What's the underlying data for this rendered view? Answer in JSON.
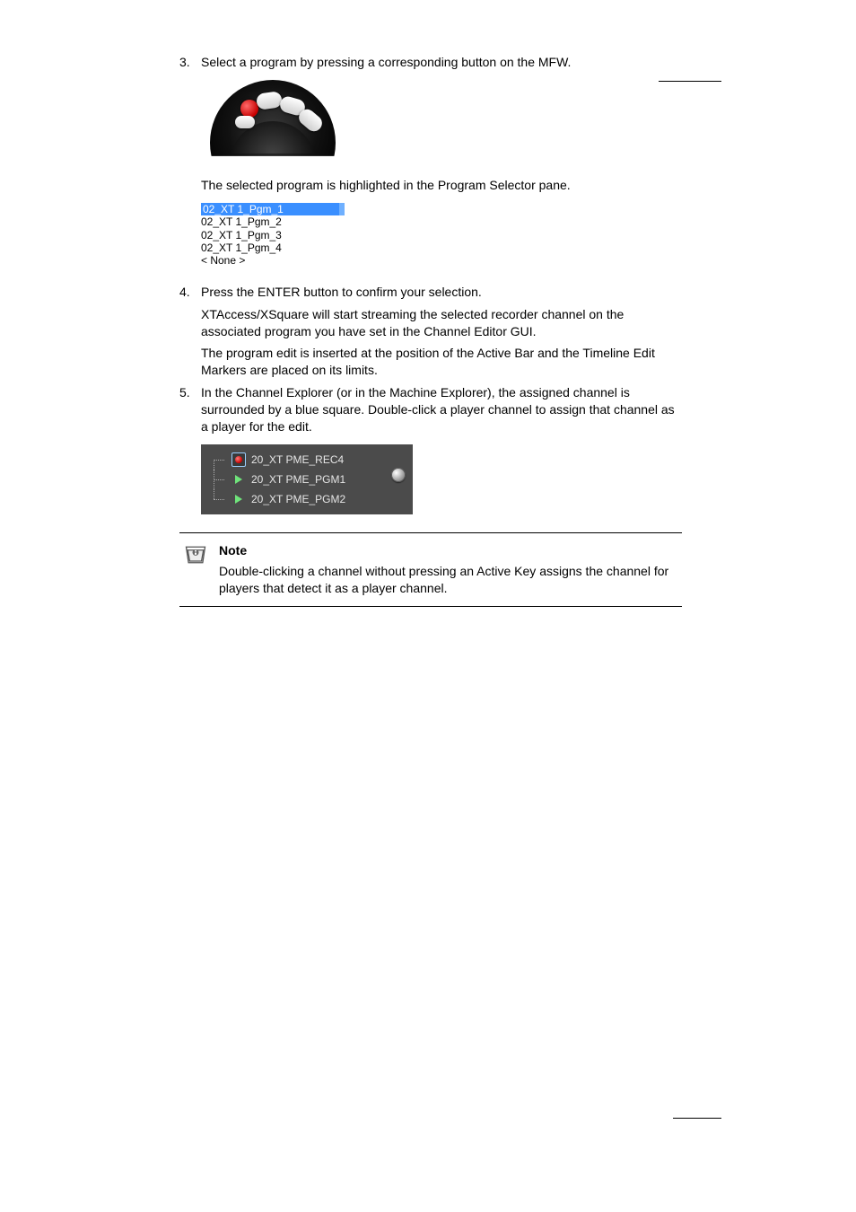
{
  "steps": {
    "s3": {
      "num": "3.",
      "text": "Select a program by pressing a corresponding button on the MFW."
    },
    "s3b": "The selected program is highlighted in the Program Selector pane.",
    "s4": {
      "num": "4.",
      "text": "Press the ENTER button to confirm your selection."
    },
    "s4b": "XTAccess/XSquare will start streaming the selected recorder channel on the associated program you have set in the Channel Editor GUI.",
    "s4c": "The program edit is inserted at the position of the Active Bar and the Timeline Edit Markers are placed on its limits.",
    "s5": {
      "num": "5.",
      "text": "In the Channel Explorer (or in the Machine Explorer), the assigned channel is surrounded by a blue square. Double-click a player channel to assign that channel as a player for the edit."
    }
  },
  "jog_name": "mfw-jog-dial",
  "programs": {
    "items": [
      "02_XT 1_Pgm_1",
      "02_XT 1_Pgm_2",
      "02_XT 1_Pgm_3",
      "02_XT 1_Pgm_4",
      "< None >"
    ]
  },
  "tree": {
    "rows": [
      {
        "icon": "rec",
        "label": "20_XT PME_REC4"
      },
      {
        "icon": "play",
        "label": "20_XT PME_PGM1"
      },
      {
        "icon": "play",
        "label": "20_XT PME_PGM2"
      }
    ],
    "disc_name": "disc-icon"
  },
  "note": {
    "title": "Note",
    "text": "Double-clicking a channel without pressing an Active Key assigns the channel for players that detect it as a player channel."
  }
}
